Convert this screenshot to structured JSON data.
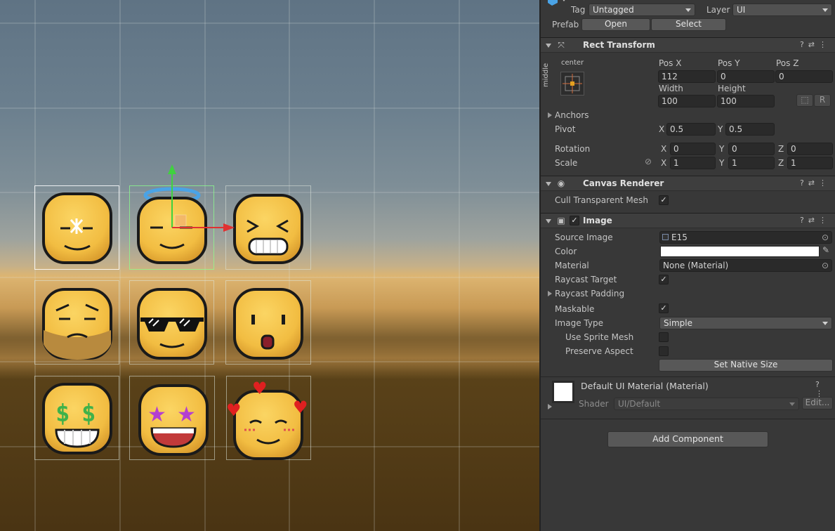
{
  "inspector": {
    "tag_label": "Tag",
    "tag_value": "Untagged",
    "layer_label": "Layer",
    "layer_value": "UI",
    "prefab_label": "Prefab",
    "prefab_open": "Open",
    "prefab_select": "Select",
    "rect_transform": {
      "title": "Rect Transform",
      "anchor_h": "center",
      "anchor_v": "middle",
      "pos_x_label": "Pos X",
      "pos_x": "112",
      "pos_y_label": "Pos Y",
      "pos_y": "0",
      "pos_z_label": "Pos Z",
      "pos_z": "0",
      "width_label": "Width",
      "width": "100",
      "height_label": "Height",
      "height": "100",
      "r_button": "R",
      "anchors_label": "Anchors",
      "pivot_label": "Pivot",
      "pivot_x_label": "X",
      "pivot_x": "0.5",
      "pivot_y_label": "Y",
      "pivot_y": "0.5",
      "rotation_label": "Rotation",
      "rot_x_label": "X",
      "rot_x": "0",
      "rot_y_label": "Y",
      "rot_y": "0",
      "rot_z_label": "Z",
      "rot_z": "0",
      "scale_label": "Scale",
      "scale_x_label": "X",
      "scale_x": "1",
      "scale_y_label": "Y",
      "scale_y": "1",
      "scale_z_label": "Z",
      "scale_z": "1"
    },
    "canvas_renderer": {
      "title": "Canvas Renderer",
      "cull_label": "Cull Transparent Mesh",
      "cull_checked": "✓"
    },
    "image": {
      "title": "Image",
      "enabled": "✓",
      "source_image_label": "Source Image",
      "source_image_value": "E15",
      "color_label": "Color",
      "color_value": "#ffffff",
      "material_label": "Material",
      "material_value": "None (Material)",
      "raycast_target_label": "Raycast Target",
      "raycast_target_checked": "✓",
      "raycast_padding_label": "Raycast Padding",
      "maskable_label": "Maskable",
      "maskable_checked": "✓",
      "image_type_label": "Image Type",
      "image_type_value": "Simple",
      "use_sprite_mesh_label": "Use Sprite Mesh",
      "preserve_aspect_label": "Preserve Aspect",
      "set_native_size": "Set Native Size"
    },
    "material": {
      "title": "Default UI Material (Material)",
      "shader_label": "Shader",
      "shader_value": "UI/Default",
      "edit_button": "Edit..."
    },
    "add_component": "Add Component"
  },
  "scene": {
    "emojis": [
      "sleepy-face",
      "angel-face",
      "laughing-face",
      "worried-bearded-face",
      "sunglasses-face",
      "surprised-face",
      "money-eyes-face",
      "star-eyes-face",
      "in-love-face"
    ]
  },
  "colors": {
    "emoji_yellow": "#f5c445",
    "emoji_shadow": "#d99a2b",
    "outline": "#1a1a1a",
    "gizmo_green": "#3fd23f",
    "gizmo_red": "#e03131"
  }
}
